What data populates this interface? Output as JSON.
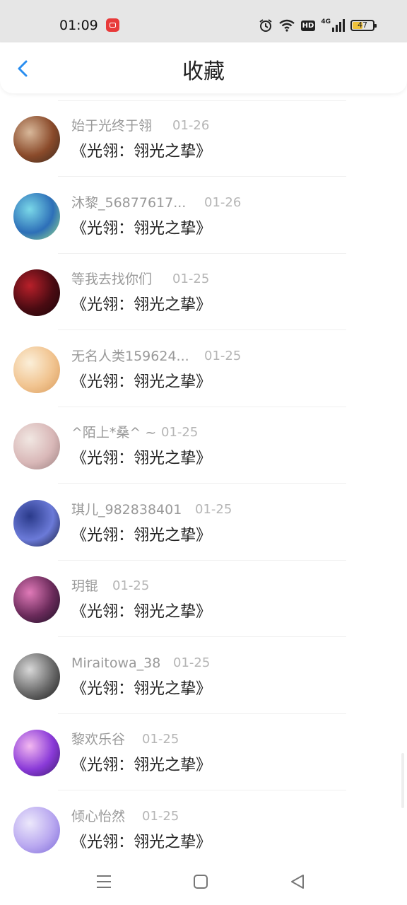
{
  "status": {
    "time": "01:09",
    "battery": "47",
    "network": "4G",
    "hd": "HD"
  },
  "header": {
    "title": "收藏"
  },
  "items": [
    {
      "name": "始于光终于翎",
      "date": "01-26",
      "title": "《光翎：翎光之挚》",
      "avatar_colors": [
        "#d8b89a",
        "#8a4a2a",
        "#3a2a1f"
      ]
    },
    {
      "name": "沐黎_56877617...",
      "date": "01-26",
      "title": "《光翎：翎光之挚》",
      "avatar_colors": [
        "#7ad8e8",
        "#2d6fb8",
        "#9be08a"
      ]
    },
    {
      "name": "等我去找你们",
      "date": "01-25",
      "title": "《光翎：翎光之挚》",
      "avatar_colors": [
        "#b8202a",
        "#4a0b12",
        "#1a0508"
      ]
    },
    {
      "name": "无名人类159624...",
      "date": "01-25",
      "title": "《光翎：翎光之挚》",
      "avatar_colors": [
        "#fbefd9",
        "#f1c490",
        "#d89a5a"
      ]
    },
    {
      "name": "^陌上*桑^ ~",
      "date": "01-25",
      "title": "《光翎：翎光之挚》",
      "avatar_colors": [
        "#f1e7e2",
        "#d9b8b8",
        "#9a7f7f"
      ]
    },
    {
      "name": "琪儿_982838401",
      "date": "01-25",
      "title": "《光翎：翎光之挚》",
      "avatar_colors": [
        "#2a3a8a",
        "#6b7ad8",
        "#141a3a"
      ]
    },
    {
      "name": "玥锟",
      "date": "01-25",
      "title": "《光翎：翎光之挚》",
      "avatar_colors": [
        "#e07ab8",
        "#6a2a5a",
        "#1a1024"
      ]
    },
    {
      "name": "Miraitowa_38",
      "date": "01-25",
      "title": "《光翎：翎光之挚》",
      "avatar_colors": [
        "#d8d8d8",
        "#6a6a6a",
        "#1a1a1a"
      ]
    },
    {
      "name": "黎欢乐谷",
      "date": "01-25",
      "title": "《光翎：翎光之挚》",
      "avatar_colors": [
        "#f3b8f0",
        "#8a3ad8",
        "#3a1a6a"
      ]
    },
    {
      "name": "倾心怡然",
      "date": "01-25",
      "title": "《光翎：翎光之挚》",
      "avatar_colors": [
        "#ece8fb",
        "#b9a8f0",
        "#7c6ad8"
      ]
    }
  ]
}
